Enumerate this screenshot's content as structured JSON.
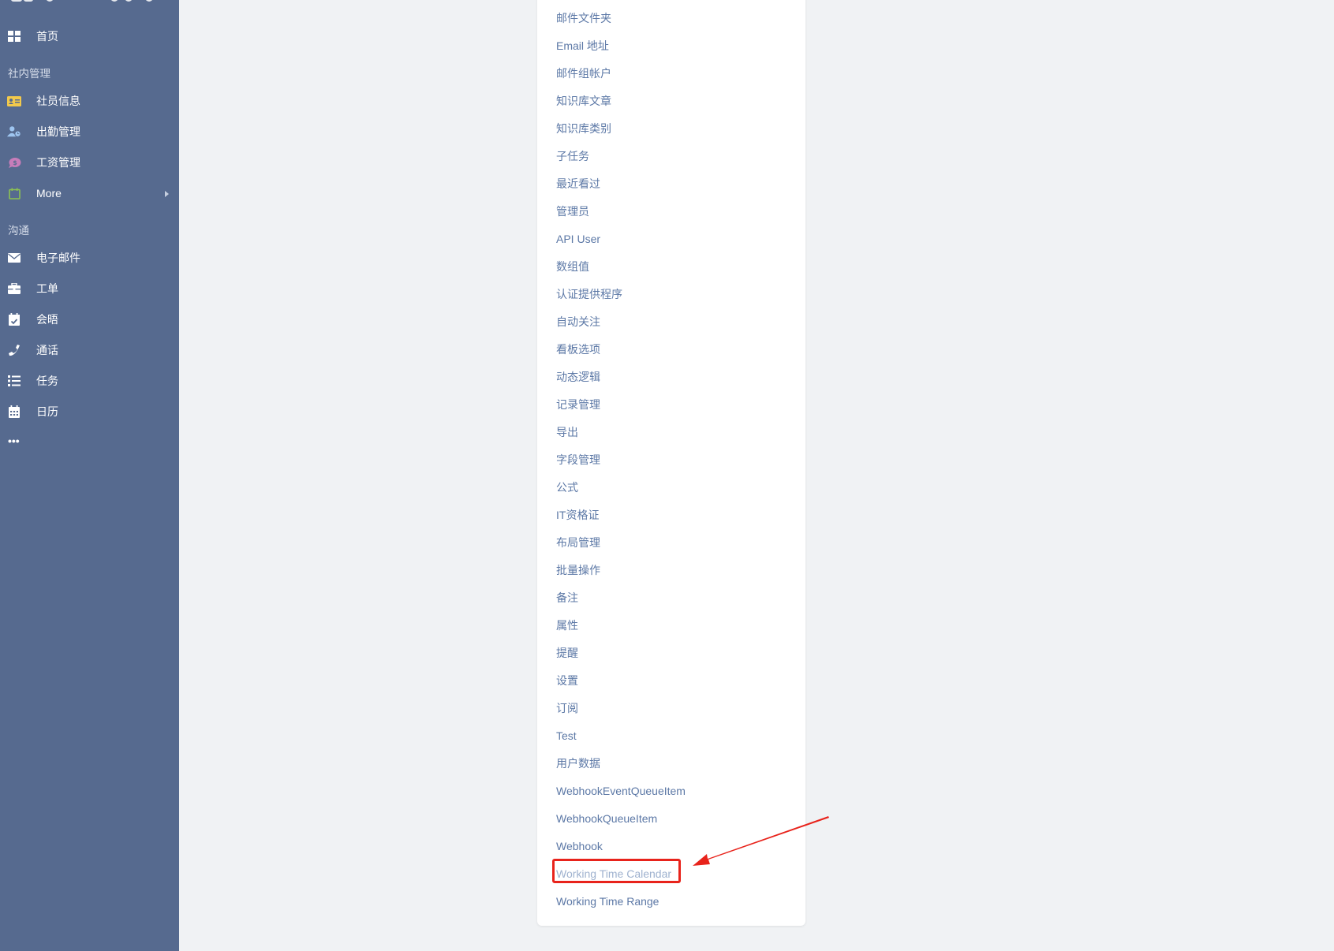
{
  "sidebar": {
    "items": [
      {
        "label": "首页",
        "icon": "dashboard-grid-icon"
      },
      {
        "label": "社员信息",
        "icon": "id-card-icon"
      },
      {
        "label": "出勤管理",
        "icon": "user-clock-icon"
      },
      {
        "label": "工资管理",
        "icon": "money-bubble-icon"
      },
      {
        "label": "More",
        "icon": "calendar-outline-icon"
      },
      {
        "label": "电子邮件",
        "icon": "envelope-icon"
      },
      {
        "label": "工单",
        "icon": "briefcase-icon"
      },
      {
        "label": "会晤",
        "icon": "calendar-check-icon"
      },
      {
        "label": "通话",
        "icon": "phone-icon"
      },
      {
        "label": "任务",
        "icon": "task-list-icon"
      },
      {
        "label": "日历",
        "icon": "calendar-grid-icon"
      }
    ],
    "sections": {
      "internal": "社内管理",
      "communication": "沟通"
    },
    "more_dots": "•••"
  },
  "entity_list": {
    "items": [
      "邮件文件夹",
      "Email 地址",
      "邮件组帐户",
      "知识库文章",
      "知识库类别",
      "子任务",
      "最近看过",
      "管理员",
      "API User",
      "数组值",
      "认证提供程序",
      "自动关注",
      "看板选项",
      "动态逻辑",
      "记录管理",
      "导出",
      "字段管理",
      "公式",
      "IT资格证",
      "布局管理",
      "批量操作",
      "备注",
      "属性",
      "提醒",
      "设置",
      "订阅",
      "Test",
      "用户数据",
      "WebhookEventQueueItem",
      "WebhookQueueItem",
      "Webhook",
      "Working Time Calendar",
      "Working Time Range"
    ],
    "highlighted": "Working Time Calendar"
  },
  "colors": {
    "sidebar_bg": "#566a8f",
    "page_bg": "#f0f2f4",
    "link": "#5c78a6",
    "link_hover": "#9fb2cf",
    "annotation": "#e8231b",
    "icon_id_card": "#f2c94c",
    "icon_user_clock": "#9ec5f0",
    "icon_money": "#c77dba",
    "icon_calendar_outline": "#8cc152"
  }
}
